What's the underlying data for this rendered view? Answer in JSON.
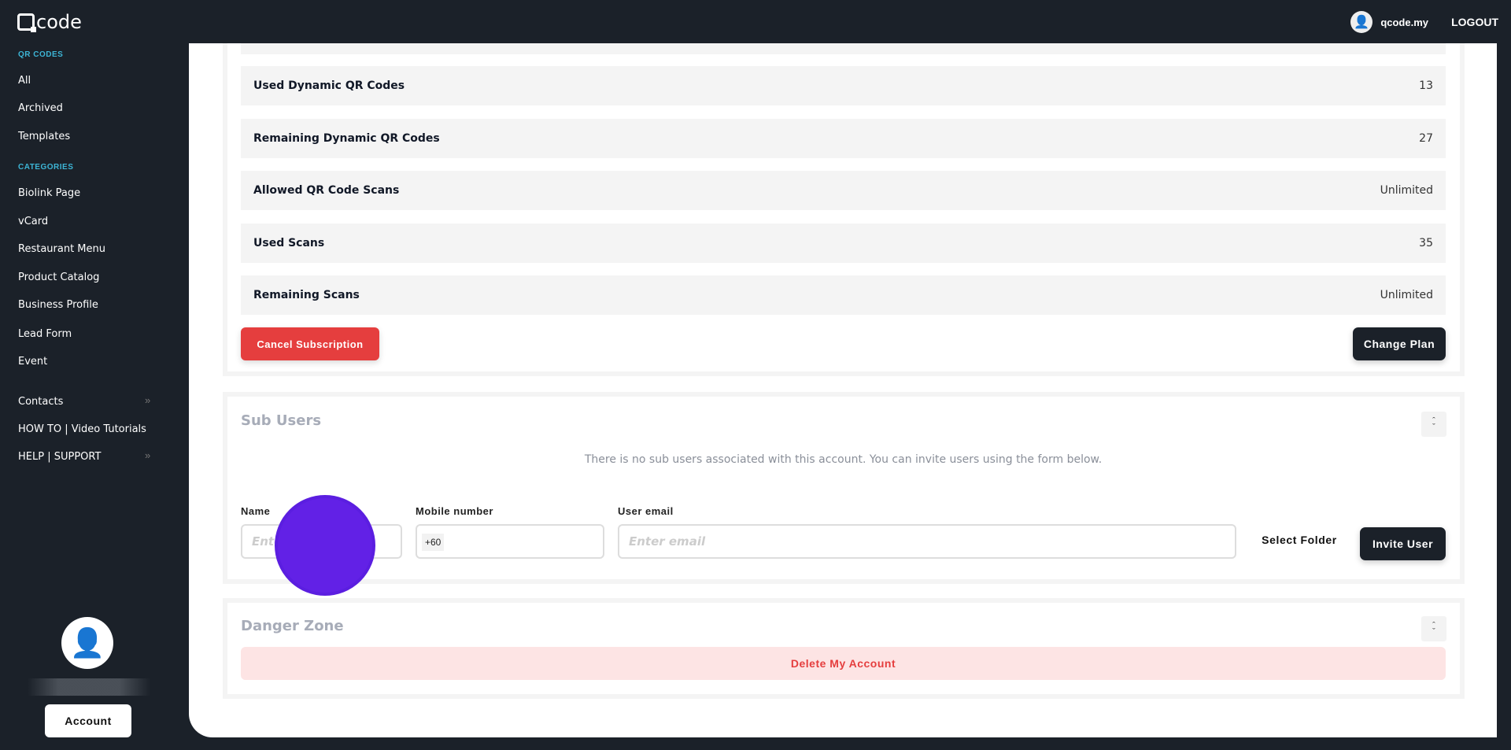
{
  "header": {
    "logo": "code",
    "user": "qcode.my",
    "logout": "LOGOUT"
  },
  "sidebar": {
    "section_qr": "QR CODES",
    "qr_items": [
      {
        "label": "All"
      },
      {
        "label": "Archived"
      },
      {
        "label": "Templates"
      }
    ],
    "section_categories": "CATEGORIES",
    "category_items": [
      {
        "label": "Biolink Page"
      },
      {
        "label": "vCard"
      },
      {
        "label": "Restaurant Menu"
      },
      {
        "label": "Product Catalog"
      },
      {
        "label": "Business Profile"
      },
      {
        "label": "Lead Form"
      },
      {
        "label": "Event"
      }
    ],
    "extra_items": [
      {
        "label": "Contacts",
        "icon": "double-chevron-right"
      },
      {
        "label": "HOW TO | Video Tutorials"
      },
      {
        "label": "HELP | SUPPORT",
        "icon": "double-chevron-right"
      }
    ],
    "account_button": "Account"
  },
  "subscription": {
    "rows": [
      {
        "label": "Used Dynamic QR Codes",
        "value": "13"
      },
      {
        "label": "Remaining Dynamic QR Codes",
        "value": "27"
      },
      {
        "label": "Allowed QR Code Scans",
        "value": "Unlimited"
      },
      {
        "label": "Used Scans",
        "value": "35"
      },
      {
        "label": "Remaining Scans",
        "value": "Unlimited"
      }
    ],
    "cancel_button": "Cancel Subscription",
    "change_button": "Change Plan"
  },
  "sub_users": {
    "title": "Sub Users",
    "message": "There is no sub users associated with this account. You can invite users using the form below.",
    "name_label": "Name",
    "name_placeholder": "Enter name",
    "mobile_label": "Mobile number",
    "mobile_prefix": "+60",
    "email_label": "User email",
    "email_placeholder": "Enter email",
    "select_folder": "Select Folder",
    "invite_button": "Invite User"
  },
  "danger_zone": {
    "title": "Danger Zone",
    "delete_button": "Delete My Account"
  },
  "colors": {
    "sidebar": "#1b2129",
    "accent": "#3db5d6",
    "danger": "#e53e3e",
    "cursor": "#6221e6"
  }
}
